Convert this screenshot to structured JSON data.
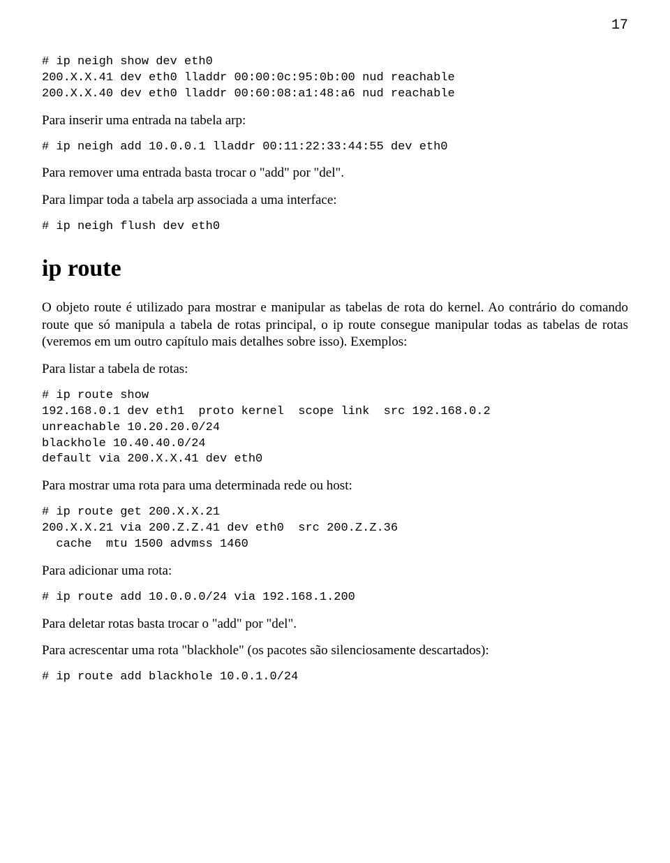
{
  "page_number": "17",
  "code1": "# ip neigh show dev eth0\n200.X.X.41 dev eth0 lladdr 00:00:0c:95:0b:00 nud reachable\n200.X.X.40 dev eth0 lladdr 00:60:08:a1:48:a6 nud reachable",
  "p1": "Para inserir uma entrada na tabela arp:",
  "code2": "# ip neigh add 10.0.0.1 lladdr 00:11:22:33:44:55 dev eth0",
  "p2": "Para remover uma entrada basta trocar o \"add\" por \"del\".",
  "p3": "Para limpar toda a tabela arp associada a uma interface:",
  "code3": "# ip neigh flush dev eth0",
  "h1": "ip route",
  "p4": "O objeto route é utilizado para mostrar e manipular as tabelas de rota do kernel. Ao contrário do comando route que só manipula a tabela de rotas principal, o ip route consegue manipular todas as tabelas de rotas (veremos em um outro capítulo mais detalhes sobre isso). Exemplos:",
  "p5": "Para listar a tabela de rotas:",
  "code4": "# ip route show\n192.168.0.1 dev eth1  proto kernel  scope link  src 192.168.0.2\nunreachable 10.20.20.0/24\nblackhole 10.40.40.0/24\ndefault via 200.X.X.41 dev eth0",
  "p6": "Para mostrar uma rota para uma determinada rede ou host:",
  "code5": "# ip route get 200.X.X.21\n200.X.X.21 via 200.Z.Z.41 dev eth0  src 200.Z.Z.36\n  cache  mtu 1500 advmss 1460",
  "p7": "Para adicionar uma rota:",
  "code6": "# ip route add 10.0.0.0/24 via 192.168.1.200",
  "p8": "Para deletar rotas basta trocar o \"add\" por \"del\".",
  "p9": "Para acrescentar uma rota \"blackhole\" (os pacotes são silenciosamente descartados):",
  "code7": "# ip route add blackhole 10.0.1.0/24"
}
